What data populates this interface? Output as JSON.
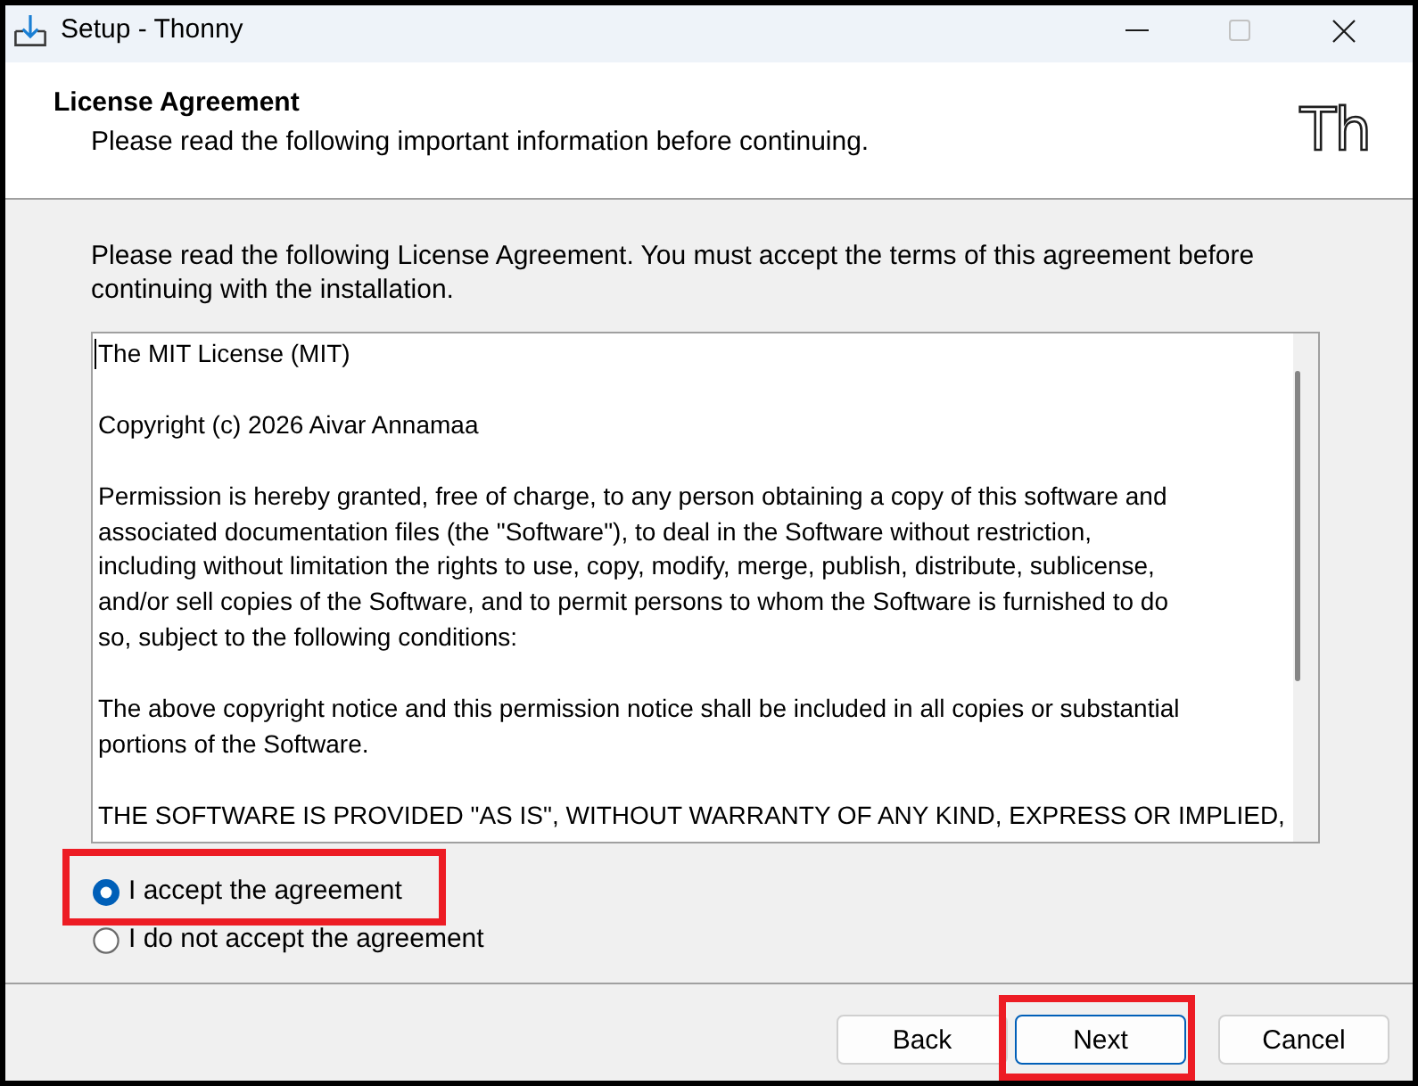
{
  "window": {
    "title": "Setup - Thonny",
    "maximize_disabled": true
  },
  "header": {
    "title": "License Agreement",
    "subtitle": "Please read the following important information before continuing.",
    "logo_text": "Th"
  },
  "intro": {
    "lines": [
      "Please read the following License Agreement. You must accept the terms of this agreement before",
      "continuing with the installation."
    ]
  },
  "license_text": {
    "paragraphs": [
      {
        "lines": [
          "The MIT License (MIT)"
        ]
      },
      {
        "lines": [
          "Copyright (c) 2026 Aivar Annamaa"
        ]
      },
      {
        "lines": [
          "Permission is hereby granted, free of charge, to any person obtaining a copy of this software and",
          "associated documentation files (the \"Software\"), to deal in the Software without restriction,",
          "including without limitation the rights to use, copy, modify, merge, publish, distribute, sublicense,",
          "and/or sell copies of the Software, and to permit persons to whom the Software is furnished to do",
          "so, subject to the following conditions:"
        ]
      },
      {
        "lines": [
          "The above copyright notice and this permission notice shall be included in all copies or substantial",
          "portions of the Software."
        ]
      },
      {
        "lines": [
          "THE SOFTWARE IS PROVIDED \"AS IS\", WITHOUT WARRANTY OF ANY KIND, EXPRESS OR IMPLIED,"
        ]
      }
    ]
  },
  "options": [
    {
      "label": "I accept the agreement",
      "selected": true,
      "highlighted": true
    },
    {
      "label": "I do not accept the agreement",
      "selected": false,
      "highlighted": false
    }
  ],
  "buttons": [
    {
      "label": "Back",
      "default": false,
      "highlighted": false
    },
    {
      "label": "Next",
      "default": true,
      "highlighted": true
    },
    {
      "label": "Cancel",
      "default": false,
      "highlighted": false
    }
  ]
}
